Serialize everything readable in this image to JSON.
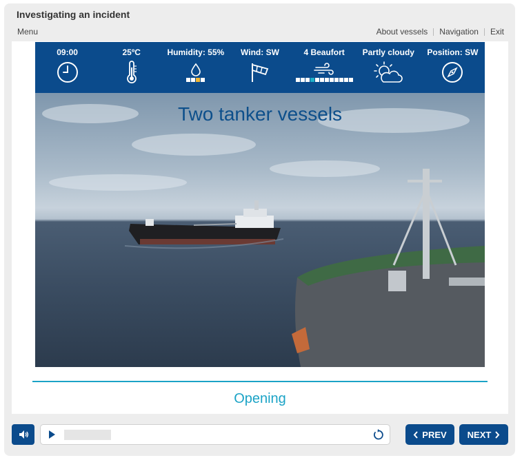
{
  "header": {
    "title": "Investigating an incident",
    "menu_label": "Menu",
    "links": [
      "About vessels",
      "Navigation",
      "Exit"
    ]
  },
  "weather": {
    "time": "09:00",
    "temperature": "25ºC",
    "humidity": "Humidity: 55%",
    "wind": "Wind: SW",
    "beaufort": "4 Beaufort",
    "sky": "Partly cloudy",
    "position": "Position: SW",
    "humidity_scale": {
      "segments": 4,
      "active": 3
    },
    "beaufort_scale": {
      "segments": 12,
      "active": 4
    },
    "icons": [
      "clock-icon",
      "thermometer-icon",
      "droplet-icon",
      "windsock-icon",
      "wind-icon",
      "partly-cloudy-icon",
      "compass-icon"
    ]
  },
  "scene": {
    "caption": "Two tanker vessels"
  },
  "section": {
    "title": "Opening"
  },
  "controls": {
    "prev_label": "PREV",
    "next_label": "NEXT",
    "progress": 0.0
  },
  "colors": {
    "primary": "#0b4b8c",
    "accent": "#1ba3c6",
    "scale_highlight_yellow": "#f2b632",
    "scale_highlight_teal": "#1fb0c8"
  }
}
